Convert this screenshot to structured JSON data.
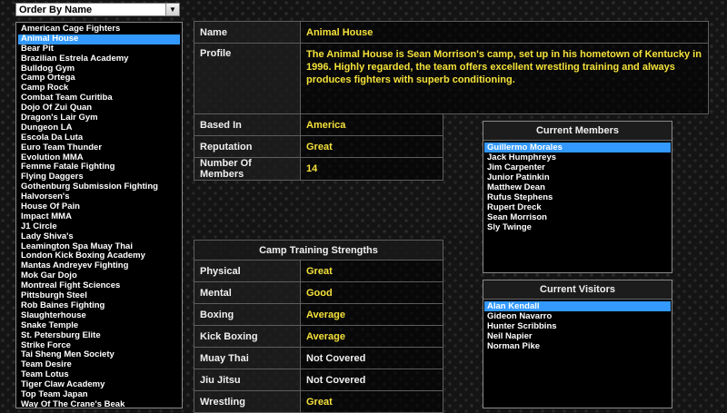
{
  "order_dropdown": {
    "value": "Order By Name"
  },
  "camps": {
    "selected_index": 1,
    "items": [
      "American Cage Fighters",
      "Animal House",
      "Bear Pit",
      "Brazilian Estrela Academy",
      "Bulldog Gym",
      "Camp Ortega",
      "Camp Rock",
      "Combat Team Curitiba",
      "Dojo Of Zui Quan",
      "Dragon's Lair Gym",
      "Dungeon LA",
      "Escola Da Luta",
      "Euro Team Thunder",
      "Evolution MMA",
      "Femme Fatale Fighting",
      "Flying Daggers",
      "Gothenburg Submission Fighting",
      "Halvorsen's",
      "House Of Pain",
      "Impact MMA",
      "J1 Circle",
      "Lady Shiva's",
      "Leamington Spa Muay Thai",
      "London Kick Boxing Academy",
      "Mantas Andreyev Fighting",
      "Mok Gar Dojo",
      "Montreal Fight Sciences",
      "Pittsburgh Steel",
      "Rob Baines Fighting",
      "Slaughterhouse",
      "Snake Temple",
      "St. Petersburg Elite",
      "Strike Force",
      "Tai Sheng Men Society",
      "Team Desire",
      "Team Lotus",
      "Tiger Claw Academy",
      "Top Team Japan",
      "Way Of The Crane's Beak"
    ]
  },
  "info": {
    "name_label": "Name",
    "name_value": "Animal House",
    "profile_label": "Profile",
    "profile_value": "The Animal House is Sean Morrison's camp, set up in his hometown of Kentucky in 1996. Highly regarded, the team offers excellent wrestling training and always produces fighters with superb conditioning."
  },
  "details": {
    "based_in_label": "Based In",
    "based_in_value": "America",
    "reputation_label": "Reputation",
    "reputation_value": "Great",
    "members_count_label": "Number Of Members",
    "members_count_value": "14"
  },
  "strengths": {
    "title": "Camp Training Strengths",
    "rows": [
      {
        "label": "Physical",
        "value": "Great"
      },
      {
        "label": "Mental",
        "value": "Good"
      },
      {
        "label": "Boxing",
        "value": "Average"
      },
      {
        "label": "Kick Boxing",
        "value": "Average"
      },
      {
        "label": "Muay Thai",
        "value": "Not Covered"
      },
      {
        "label": "Jiu Jitsu",
        "value": "Not Covered"
      },
      {
        "label": "Wrestling",
        "value": "Great"
      }
    ]
  },
  "members": {
    "title": "Current Members",
    "selected_index": 0,
    "items": [
      "Guillermo Morales",
      "Jack Humphreys",
      "Jim Carpenter",
      "Junior Patinkin",
      "Matthew Dean",
      "Rufus Stephens",
      "Rupert Dreck",
      "Sean Morrison",
      "Sly Twinge"
    ]
  },
  "visitors": {
    "title": "Current Visitors",
    "selected_index": 0,
    "items": [
      "Alan Kendall",
      "Gideon Navarro",
      "Hunter Scribbins",
      "Neil Napier",
      "Norman Pike"
    ]
  },
  "colors": {
    "highlight": "#f5e23a",
    "selection": "#3399ff"
  }
}
